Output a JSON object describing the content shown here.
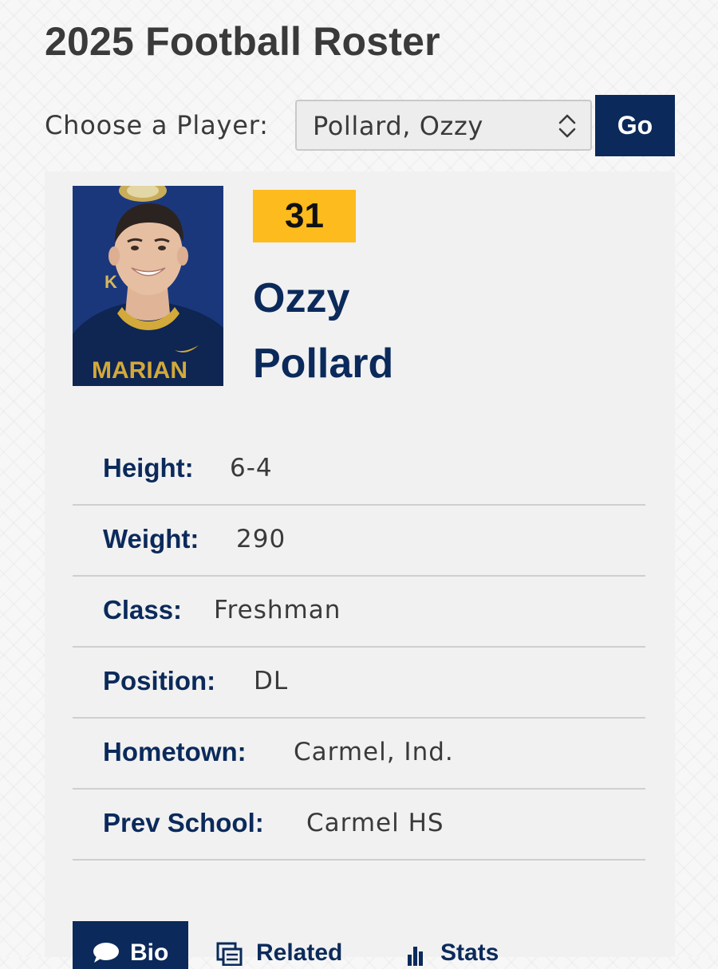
{
  "page": {
    "title": "2025 Football Roster"
  },
  "player_select": {
    "label": "Choose a Player:",
    "selected": "Pollard, Ozzy",
    "go_label": "Go"
  },
  "player": {
    "number": "31",
    "first_name": "Ozzy",
    "last_name": "Pollard",
    "photo_jersey_text": "MARIAN",
    "attributes": [
      {
        "label": "Height:",
        "value": "6-4"
      },
      {
        "label": "Weight:",
        "value": "290"
      },
      {
        "label": "Class:",
        "value": "Freshman"
      },
      {
        "label": "Position:",
        "value": "DL"
      },
      {
        "label": "Hometown:",
        "value": "Carmel, Ind."
      },
      {
        "label": "Prev School:",
        "value": "Carmel HS"
      }
    ]
  },
  "tabs": [
    {
      "label": "Bio",
      "icon": "speech-bubble-icon",
      "active": true
    },
    {
      "label": "Related",
      "icon": "documents-icon",
      "active": false
    },
    {
      "label": "Stats",
      "icon": "bar-chart-icon",
      "active": false
    }
  ],
  "colors": {
    "navy": "#0b2a5b",
    "gold": "#fdbb1e",
    "card_background": "#f1f1f1",
    "text_gray": "#3a3a3a"
  }
}
